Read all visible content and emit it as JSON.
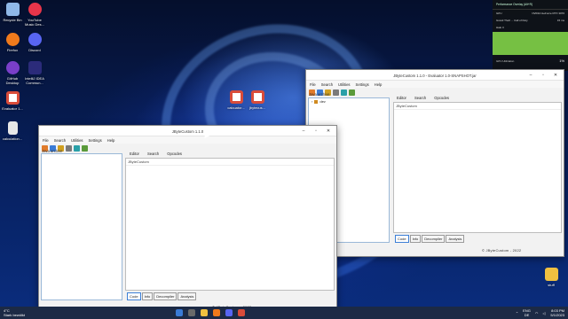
{
  "desktop": {
    "icons": [
      {
        "label": "Recycle Bin",
        "color": "#8fb8e8"
      },
      {
        "label": "YouTube Music Des...",
        "color": "#e8354a"
      },
      {
        "label": "Firefox",
        "color": "#f07a1c"
      },
      {
        "label": "Discord",
        "color": "#5865f2"
      },
      {
        "label": "GitHub Desktop",
        "color": "#7a3fc9"
      },
      {
        "label": "IntelliJ IDEA Commun...",
        "color": "#2b2b7a"
      },
      {
        "label": "Evaluator 1...",
        "color": "#d94c3a"
      },
      {
        "label": "calculation...",
        "color": "#e8e8e8"
      },
      {
        "label": "stuff",
        "color": "#f0c040"
      }
    ],
    "jar_icons": [
      {
        "label": "calcuator...",
        "color": "#e8e8e8"
      },
      {
        "label": "jbytecus...",
        "color": "#e8e8e8"
      }
    ]
  },
  "overlay": {
    "title": "Performance Overlay (Alt+R)",
    "gpu_label": "GPU",
    "gpu_name": "NVIDIA GeForce RTX 3070",
    "game_label": "Grand Theft ... Call of Duty",
    "game_sub": "Halo 3",
    "fps": "15 ms",
    "util_label": "GPU Utilization",
    "util_pct": "1%",
    "bar_color": "#76c043"
  },
  "back_window": {
    "title": "JByteCustom 1.1.0 - Evaluator 1.0-SNAPSHOT.jar",
    "menu": [
      "File",
      "Search",
      "Utilities",
      "Settings",
      "Help"
    ],
    "archive_label": "Java archive",
    "tree_item": "dev",
    "tabs": [
      "Editor",
      "Search",
      "Opcodes"
    ],
    "editor_header": "JByteCustom",
    "bottom_tabs": [
      "Code",
      "Info",
      "Decompiler",
      "Analysis"
    ],
    "status": "© JByteCustom - 2022"
  },
  "front_window": {
    "title": "JByteCustom 1.1.0",
    "menu": [
      "File",
      "Search",
      "Utilities",
      "Settings",
      "Help"
    ],
    "archive_label": "Java archive",
    "tabs": [
      "Editor",
      "Search",
      "Opcodes"
    ],
    "editor_header": "JByteCustom",
    "bottom_tabs": [
      "Code",
      "Info",
      "Decompiler",
      "Analysis"
    ],
    "status": "© JByteCustom - 2022"
  },
  "taskbar": {
    "weather_temp": "4°C",
    "weather_desc": "Stark bewölkt",
    "lang": "ENG",
    "region": "DE",
    "time": "8:03 PM",
    "date": "5/1/2023"
  },
  "colors": {
    "toolbar_icons": [
      "#e07b2a",
      "#3a7bd5",
      "#d0a020",
      "#7a7a7a",
      "#2aa0a8",
      "#5a9a3a"
    ]
  }
}
